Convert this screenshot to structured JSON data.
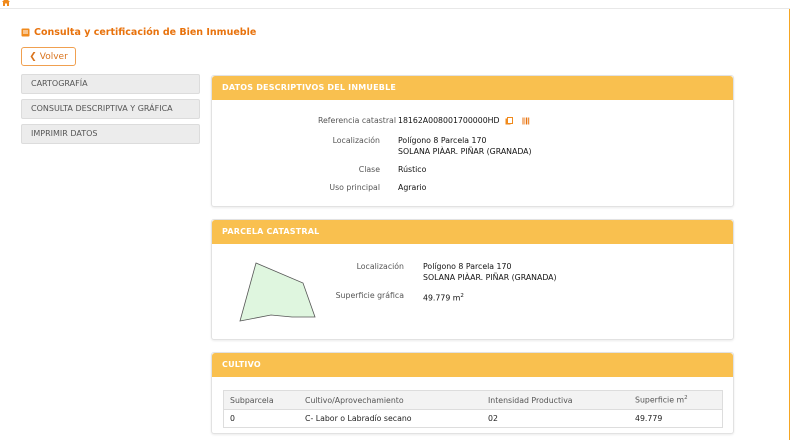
{
  "page": {
    "title": "Consulta y certificación de Bien Inmueble",
    "back_label": "Volver"
  },
  "menu": {
    "items": [
      {
        "label": "CARTOGRAFÍA"
      },
      {
        "label": "CONSULTA DESCRIPTIVA Y GRÁFICA"
      },
      {
        "label": "IMPRIMIR DATOS"
      }
    ]
  },
  "datos": {
    "header": "DATOS DESCRIPTIVOS DEL INMUEBLE",
    "ref_label": "Referencia catastral",
    "ref_value": "18162A008001700000HD",
    "loc_label": "Localización",
    "loc_line1": "Polígono 8 Parcela 170",
    "loc_line2": "SOLANA PIÀAR. PIÑAR (GRANADA)",
    "clase_label": "Clase",
    "clase_value": "Rústico",
    "uso_label": "Uso principal",
    "uso_value": "Agrario"
  },
  "parcela": {
    "header": "PARCELA CATASTRAL",
    "loc_label": "Localización",
    "loc_line1": "Polígono 8 Parcela 170",
    "loc_line2": "SOLANA PIÀAR. PIÑAR (GRANADA)",
    "sup_label": "Superficie gráfica",
    "sup_value": "49.779 m",
    "sup_unit_exp": "2"
  },
  "cultivo": {
    "header": "CULTIVO",
    "columns": [
      "Subparcela",
      "Cultivo/Aprovechamiento",
      "Intensidad Productiva",
      "Superficie m"
    ],
    "col_unit_exp": "2",
    "rows": [
      [
        "0",
        "C- Labor o Labradío secano",
        "02",
        "49.779"
      ]
    ]
  },
  "colors": {
    "accent": "#e8720c",
    "panel_header": "#f9c04f"
  },
  "icons": {
    "home": "home-icon",
    "title": "document-icon",
    "back": "chevron-left-icon",
    "copy": "copy-icon",
    "barcode": "barcode-icon"
  }
}
